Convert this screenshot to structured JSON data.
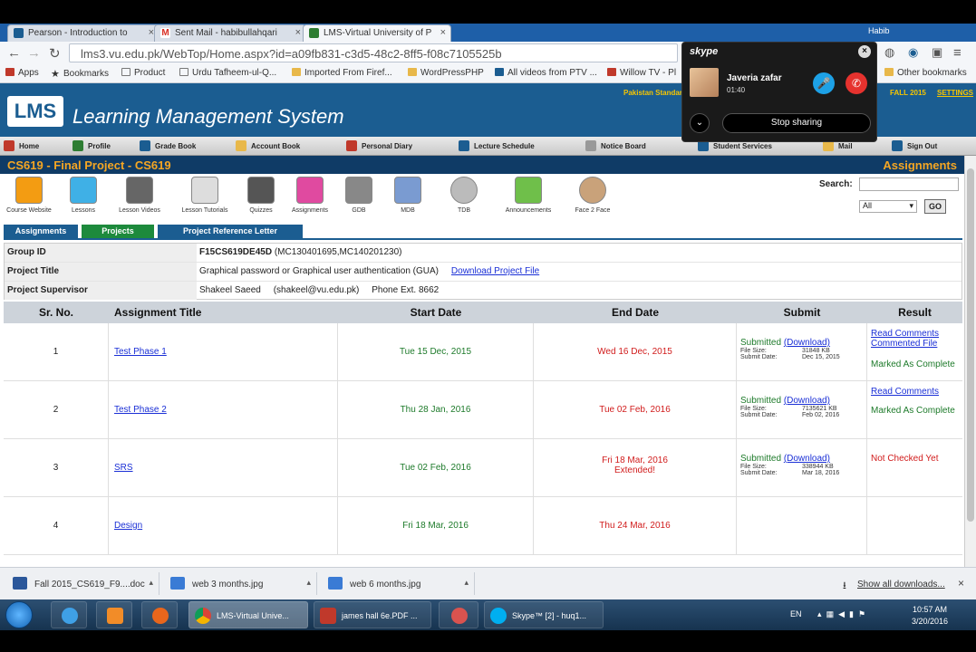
{
  "browser": {
    "tabs": [
      {
        "label": "Pearson - Introduction to",
        "color": "#1b5d91"
      },
      {
        "label": "Sent Mail - habibullahqari",
        "color": "#d93025"
      },
      {
        "label": "LMS-Virtual University of P",
        "color": "#2e7d32"
      }
    ],
    "tab_close": "×",
    "profile": "Habib",
    "url": "lms3.vu.edu.pk/WebTop/Home.aspx?id=a09fb831-c3d5-48c2-8ff5-f08c7105525b",
    "bookmarks": [
      "Apps",
      "Bookmarks",
      "Product",
      "Urdu Tafheem-ul-Q...",
      "Imported From Firef...",
      "WordPressPHP",
      "All videos from PTV ...",
      "Willow TV - Pl",
      "Other bookmarks"
    ]
  },
  "lms": {
    "logo": "LMS",
    "title": "Learning Management System",
    "header_links": [
      "Pakistan Standar",
      "FALL 2015",
      "SETTINGS"
    ],
    "menu": [
      "Home",
      "Profile",
      "Grade Book",
      "Account Book",
      "Personal Diary",
      "Lecture Schedule",
      "Notice Board",
      "Student Services",
      "Mail",
      "Sign Out"
    ],
    "course": "CS619 - Final Project - CS619",
    "section": "Assignments",
    "tools": [
      "Course Website",
      "Lessons",
      "Lesson Videos",
      "Lesson Tutorials",
      "Quizzes",
      "Assignments",
      "GDB",
      "MDB",
      "TDB",
      "Announcements",
      "Face 2 Face"
    ],
    "search_label": "Search:",
    "search_scope": "All",
    "go": "GO",
    "subtabs": [
      "Assignments",
      "Projects",
      "Project Reference Letter"
    ],
    "info": {
      "group_id_label": "Group ID",
      "group_id": "F15CS619DE45D",
      "group_members": "(MC130401695,MC140201230)",
      "title_label": "Project Title",
      "title": "Graphical password or Graphical user authentication (GUA)",
      "download_link": "Download Project File",
      "supervisor_label": "Project Supervisor",
      "supervisor": "Shakeel Saeed     (shakeel@vu.edu.pk)     Phone Ext. 8662"
    },
    "columns": [
      "Sr. No.",
      "Assignment Title",
      "Start Date",
      "End Date",
      "Submit",
      "Result"
    ],
    "rows": [
      {
        "no": "1",
        "title": "Test Phase 1",
        "start": "Tue 15 Dec, 2015",
        "end": "Wed 16 Dec, 2015",
        "end2": "",
        "submitted": "Submitted",
        "download": "(Download)",
        "size_label": "File Size:",
        "size": "31848 KB",
        "date_label": "Submit Date:",
        "date": "Dec 15, 2015",
        "result1": "Read Comments",
        "result2": "Commented File",
        "result3": "Marked As Complete"
      },
      {
        "no": "2",
        "title": "Test Phase 2",
        "start": "Thu 28 Jan, 2016",
        "end": "Tue 02 Feb, 2016",
        "end2": "",
        "submitted": "Submitted",
        "download": "(Download)",
        "size_label": "File Size:",
        "size": "7135621 KB",
        "date_label": "Submit Date:",
        "date": "Feb 02, 2016",
        "result1": "Read Comments",
        "result2": "",
        "result3": "Marked As Complete"
      },
      {
        "no": "3",
        "title": "SRS",
        "start": "Tue 02 Feb, 2016",
        "end": "Fri 18 Mar, 2016",
        "end2": "Extended!",
        "submitted": "Submitted",
        "download": "(Download)",
        "size_label": "File Size:",
        "size": "338944 KB",
        "date_label": "Submit Date:",
        "date": "Mar 18, 2016",
        "result1": "",
        "result2": "",
        "result3": "Not Checked Yet"
      },
      {
        "no": "4",
        "title": "Design",
        "start": "Fri 18 Mar, 2016",
        "end": "Thu 24 Mar, 2016",
        "end2": "",
        "submitted": "",
        "download": "",
        "size_label": "",
        "size": "",
        "date_label": "",
        "date": "",
        "result1": "",
        "result2": "",
        "result3": ""
      }
    ]
  },
  "skype": {
    "logo": "skype",
    "close": "×",
    "caller": "Javeria zafar",
    "duration": "01:40",
    "stop_sharing": "Stop sharing"
  },
  "downloads": {
    "items": [
      "Fall 2015_CS619_F9....doc",
      "web 3 months.jpg",
      "web 6 months.jpg"
    ],
    "show_all": "Show all downloads...",
    "close": "×"
  },
  "taskbar": {
    "items": [
      "LMS-Virtual Unive...",
      "james hall 6e.PDF ...",
      "Skype™ [2] - huq1..."
    ],
    "language": "EN",
    "time": "10:57 AM",
    "date": "3/20/2016"
  }
}
